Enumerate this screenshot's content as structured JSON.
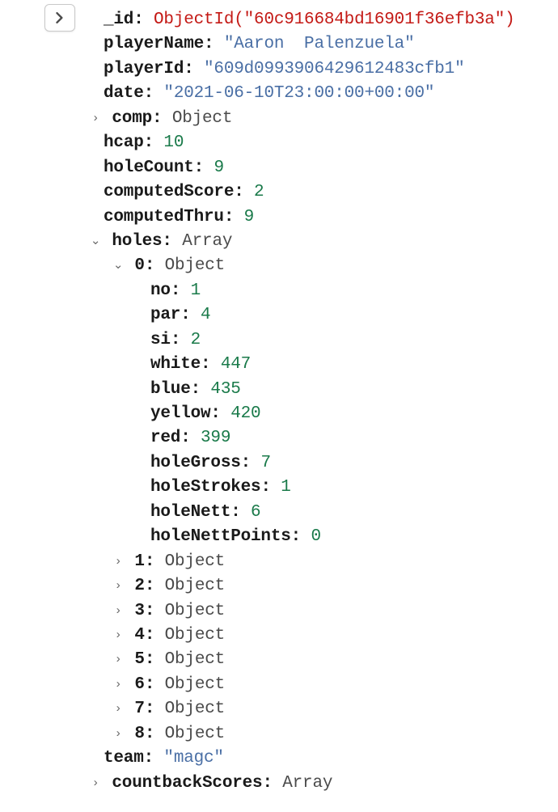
{
  "doc": {
    "_id": {
      "key": "_id",
      "value": "ObjectId(\"60c916684bd16901f36efb3a\")",
      "type": "objectid"
    },
    "playerName": {
      "key": "playerName",
      "value": "\"Aaron  Palenzuela\"",
      "type": "string"
    },
    "playerId": {
      "key": "playerId",
      "value": "\"609d0993906429612483cfb1\"",
      "type": "string"
    },
    "date": {
      "key": "date",
      "value": "\"2021-06-10T23:00:00+00:00\"",
      "type": "string"
    },
    "comp": {
      "key": "comp",
      "value": "Object",
      "type": "type"
    },
    "hcap": {
      "key": "hcap",
      "value": "10",
      "type": "number"
    },
    "holeCount": {
      "key": "holeCount",
      "value": "9",
      "type": "number"
    },
    "computedScore": {
      "key": "computedScore",
      "value": "2",
      "type": "number"
    },
    "computedThru": {
      "key": "computedThru",
      "value": "9",
      "type": "number"
    },
    "holes": {
      "key": "holes",
      "value": "Array",
      "type": "type",
      "items": [
        {
          "idx": "0",
          "value": "Object",
          "expanded": true,
          "fields": [
            {
              "key": "no",
              "value": "1",
              "type": "number"
            },
            {
              "key": "par",
              "value": "4",
              "type": "number"
            },
            {
              "key": "si",
              "value": "2",
              "type": "number"
            },
            {
              "key": "white",
              "value": "447",
              "type": "number"
            },
            {
              "key": "blue",
              "value": "435",
              "type": "number"
            },
            {
              "key": "yellow",
              "value": "420",
              "type": "number"
            },
            {
              "key": "red",
              "value": "399",
              "type": "number"
            },
            {
              "key": "holeGross",
              "value": "7",
              "type": "number"
            },
            {
              "key": "holeStrokes",
              "value": "1",
              "type": "number"
            },
            {
              "key": "holeNett",
              "value": "6",
              "type": "number"
            },
            {
              "key": "holeNettPoints",
              "value": "0",
              "type": "number"
            }
          ]
        },
        {
          "idx": "1",
          "value": "Object",
          "expanded": false
        },
        {
          "idx": "2",
          "value": "Object",
          "expanded": false
        },
        {
          "idx": "3",
          "value": "Object",
          "expanded": false
        },
        {
          "idx": "4",
          "value": "Object",
          "expanded": false
        },
        {
          "idx": "5",
          "value": "Object",
          "expanded": false
        },
        {
          "idx": "6",
          "value": "Object",
          "expanded": false
        },
        {
          "idx": "7",
          "value": "Object",
          "expanded": false
        },
        {
          "idx": "8",
          "value": "Object",
          "expanded": false
        }
      ]
    },
    "team": {
      "key": "team",
      "value": "\"magc\"",
      "type": "string"
    },
    "countbackScores": {
      "key": "countbackScores",
      "value": "Array",
      "type": "type"
    }
  },
  "glyphs": {
    "caret_right": "›",
    "caret_down": "⌄"
  }
}
